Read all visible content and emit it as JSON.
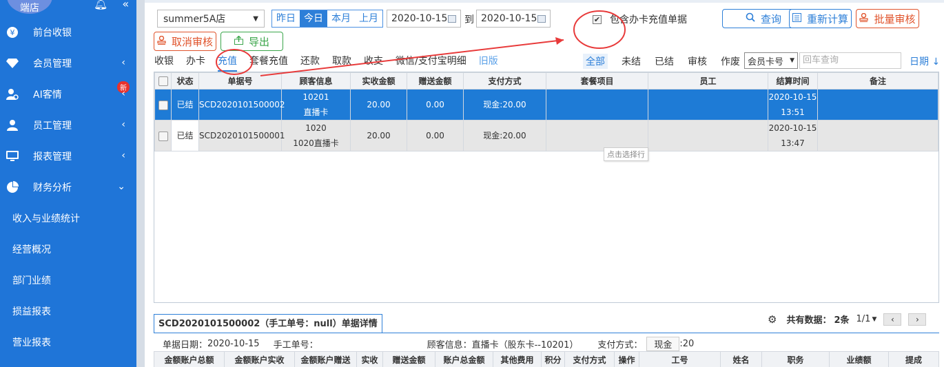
{
  "sidebar": {
    "logo": "端店",
    "items": [
      {
        "label": "前台收银",
        "icon": "yen-icon",
        "chevron": false
      },
      {
        "label": "会员管理",
        "icon": "diamond-icon",
        "chevron": true
      },
      {
        "label": "AI客情",
        "icon": "user-settings-icon",
        "chevron": true,
        "badge": "新"
      },
      {
        "label": "员工管理",
        "icon": "user-icon",
        "chevron": true
      },
      {
        "label": "报表管理",
        "icon": "monitor-icon",
        "chevron": true
      },
      {
        "label": "财务分析",
        "icon": "pie-icon",
        "chevron": true,
        "expanded": true
      }
    ],
    "subitems": [
      "收入与业绩统计",
      "经营概况",
      "部门业绩",
      "损益报表",
      "营业报表"
    ]
  },
  "toolbar": {
    "store": "summer5A店",
    "quick_dates": [
      "昨日",
      "今日",
      "本月",
      "上月"
    ],
    "quick_active": 1,
    "date_from": "2020-10-15",
    "to_label": "到",
    "date_to": "2020-10-15",
    "include_card_label": "包含办卡充值单据",
    "include_card_checked": "✔",
    "query_btn": "查询",
    "recalc_btn": "重新计算",
    "batch_audit_btn": "批量审核",
    "cancel_audit_btn": "取消审核",
    "export_btn": "导出"
  },
  "tabs": [
    "收银",
    "办卡",
    "充值",
    "套餐充值",
    "还款",
    "取款",
    "收支",
    "微信/支付宝明细",
    "旧版"
  ],
  "active_tab": 2,
  "filters": [
    "全部",
    "未结",
    "已结",
    "审核",
    "作废"
  ],
  "member_select": "会员卡号",
  "search_placeholder": "回车查询",
  "date_sort": "日期",
  "table": {
    "headers": [
      "",
      "状态",
      "单据号",
      "顾客信息",
      "实收金额",
      "赠送金额",
      "支付方式",
      "套餐项目",
      "员工",
      "结算时间",
      "备注"
    ],
    "rows": [
      {
        "status": "已结",
        "no": "SCD2020101500002",
        "cust1": "10201",
        "cust2": "直播卡",
        "paid": "20.00",
        "gift": "0.00",
        "pay": "现金:20.00",
        "pkg": "",
        "staff": "",
        "t1": "2020-10-15",
        "t2": "13:51",
        "note": "",
        "selected": true
      },
      {
        "status": "已结",
        "no": "SCD2020101500001",
        "cust1": "1020",
        "cust2": "1020直播卡",
        "paid": "20.00",
        "gift": "0.00",
        "pay": "现金:20.00",
        "pkg": "",
        "staff": "",
        "t1": "2020-10-15",
        "t2": "13:47",
        "note": "",
        "selected": false
      }
    ],
    "tooltip": "点击选择行"
  },
  "detail": {
    "title": "SCD2020101500002（手工单号：null）单据详情",
    "total_label": "共有数据：",
    "total_value": "2条",
    "page": "1/1",
    "date_label": "单据日期：",
    "date_value": "2020-10-15",
    "manual_label": "手工单号：",
    "cust_label": "顾客信息：",
    "cust_value": "直播卡（股东卡--10201）",
    "pay_label": "支付方式：",
    "pay_badge": "现金",
    "pay_value": ":20",
    "headers": [
      "金额账户总额",
      "金额账户实收",
      "金额账户赠送",
      "实收",
      "赠送金额",
      "账户总金额",
      "其他费用",
      "积分",
      "支付方式",
      "操作",
      "工号",
      "姓名",
      "职务",
      "业绩额",
      "提成"
    ]
  },
  "colors": {
    "sidebar": "#1f75d8",
    "accent": "#2d7fd8",
    "danger": "#e0532b",
    "success": "#3aa54a",
    "annotation": "#e83a3a"
  }
}
